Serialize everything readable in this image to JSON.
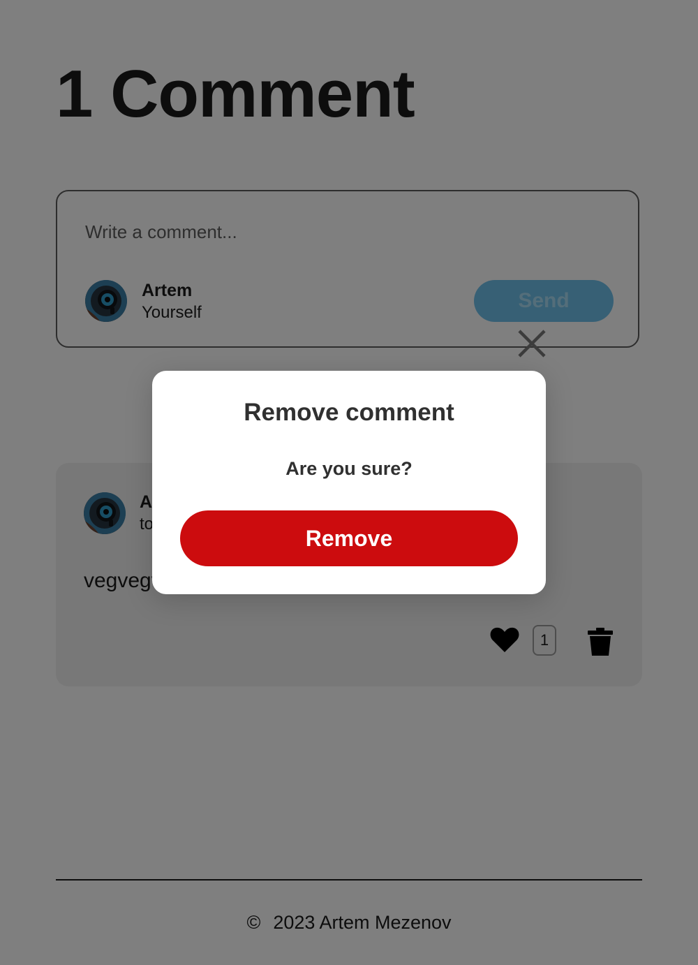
{
  "page": {
    "title": "1 Comment"
  },
  "composer": {
    "placeholder": "Write a comment...",
    "user_name": "Artem",
    "user_role": "Yourself",
    "send_label": "Send"
  },
  "comment": {
    "author": "Artem",
    "date": "today",
    "text": "vegvegvegvegveg",
    "likes": "1"
  },
  "footer": {
    "copyright_symbol": "©",
    "text": "2023 Artem Mezenov"
  },
  "modal": {
    "title": "Remove comment",
    "subtitle": "Are you sure?",
    "confirm_label": "Remove"
  },
  "colors": {
    "overlay": "rgba(0,0,0,0.5)",
    "send_button": "#6fc0ea",
    "remove_button": "#cc0c0e"
  },
  "icons": {
    "close": "close-icon",
    "like": "heart-icon",
    "delete": "trash-icon"
  }
}
